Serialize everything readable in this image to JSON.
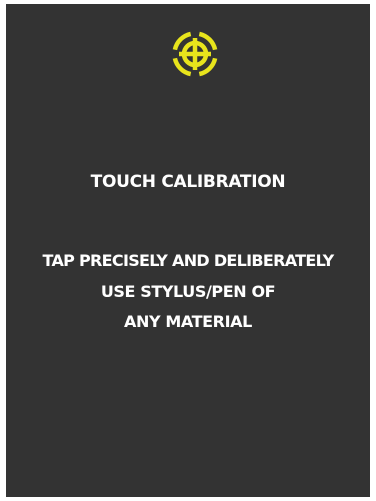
{
  "screen": {
    "background": "#333333",
    "accent": "#e8e41c",
    "target_icon": "crosshair-target-icon"
  },
  "calibration": {
    "title": "TOUCH CALIBRATION",
    "instructions": [
      "TAP PRECISELY AND DELIBERATELY",
      "USE STYLUS/PEN OF",
      "ANY MATERIAL"
    ]
  }
}
